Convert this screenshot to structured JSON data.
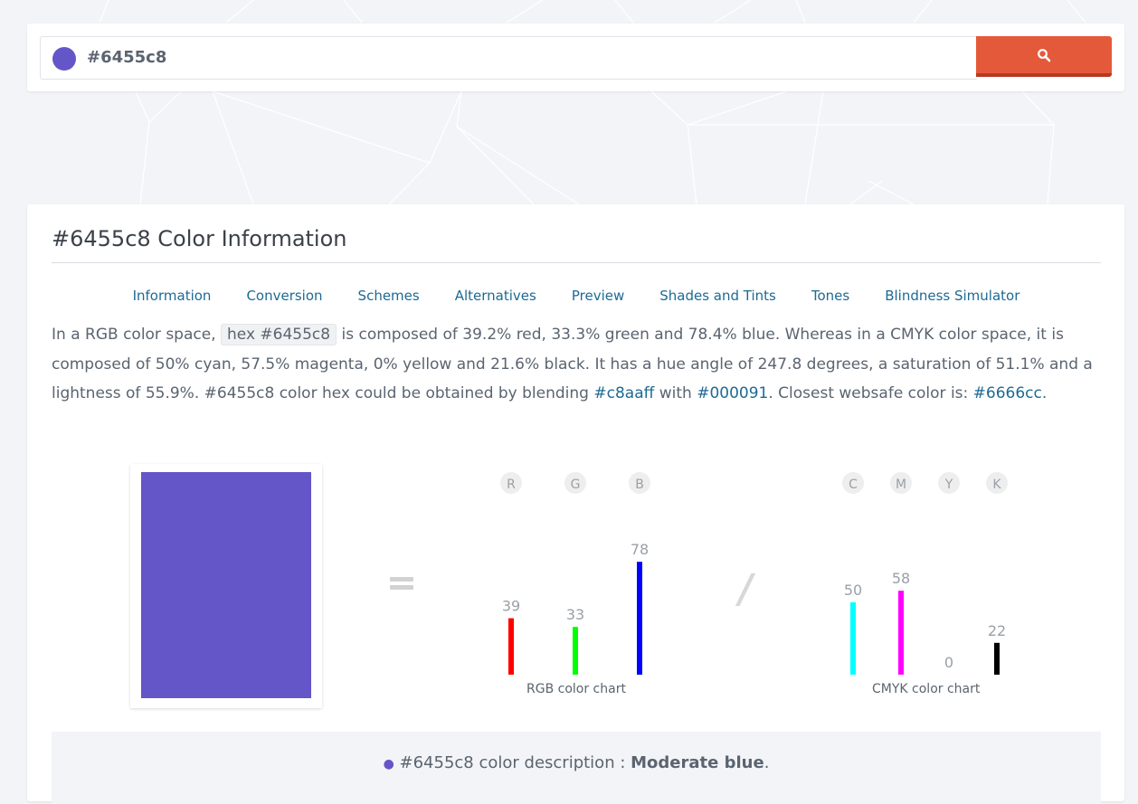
{
  "search": {
    "value": "#6455c8"
  },
  "colors": {
    "subject": "#6455c8",
    "accent_button": "#e5593b",
    "link": "#1d6a93",
    "rgb_r": "#ff0000",
    "rgb_g": "#00ff00",
    "rgb_b": "#0000ff",
    "cmyk_c": "#00ffff",
    "cmyk_m": "#ff00ff",
    "cmyk_y": "#ffff00",
    "cmyk_k": "#000000"
  },
  "icons": {
    "search_button": "search-icon"
  },
  "info": {
    "title": "#6455c8 Color Information",
    "tabs": [
      "Information",
      "Conversion",
      "Schemes",
      "Alternatives",
      "Preview",
      "Shades and Tints",
      "Tones",
      "Blindness Simulator"
    ],
    "paragraph": {
      "p1": "In a RGB color space, ",
      "chip": "hex #6455c8",
      "p2": " is composed of 39.2% red, 33.3% green and 78.4% blue. Whereas in a CMYK color space, it is composed of 50% cyan, 57.5% magenta, 0% yellow and 21.6% black. It has a hue angle of 247.8 degrees, a saturation of 51.1% and a lightness of 55.9%. #6455c8 color hex could be obtained by blending ",
      "link1": "#c8aaff",
      "p3": " with ",
      "link2": "#000091",
      "p4": ". Closest websafe color is: ",
      "link3": "#6666cc",
      "p5": "."
    },
    "description": {
      "bullet": "●",
      "prefix": " #6455c8 color description : ",
      "value": "Moderate blue",
      "suffix": "."
    }
  },
  "chart_data": [
    {
      "type": "bar",
      "title": "RGB color chart",
      "categories": [
        "R",
        "G",
        "B"
      ],
      "values": [
        39,
        33,
        78
      ],
      "ylim": [
        0,
        100
      ],
      "grid": false
    },
    {
      "type": "bar",
      "title": "CMYK color chart",
      "categories": [
        "C",
        "M",
        "Y",
        "K"
      ],
      "values": [
        50,
        58,
        0,
        22
      ],
      "ylim": [
        0,
        100
      ],
      "grid": false
    }
  ]
}
